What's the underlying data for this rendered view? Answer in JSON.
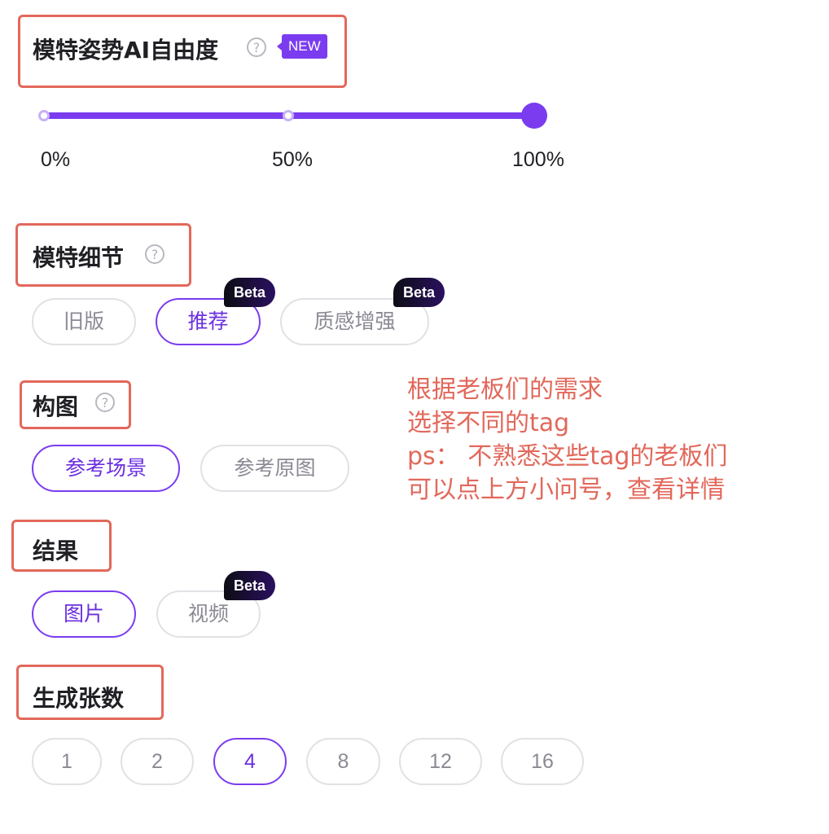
{
  "pose_freedom": {
    "title": "模特姿势AI自由度",
    "new_label": "NEW",
    "value_percent": 100,
    "ticks": [
      "0%",
      "50%",
      "100%"
    ]
  },
  "model_detail": {
    "title": "模特细节",
    "options": [
      "旧版",
      "推荐",
      "质感增强"
    ],
    "selected": "推荐",
    "beta_label": "Beta"
  },
  "composition": {
    "title": "构图",
    "options": [
      "参考场景",
      "参考原图"
    ],
    "selected": "参考场景"
  },
  "result": {
    "title": "结果",
    "options": [
      "图片",
      "视频"
    ],
    "selected": "图片",
    "beta_label": "Beta"
  },
  "count": {
    "title": "生成张数",
    "options": [
      "1",
      "2",
      "4",
      "8",
      "12",
      "16"
    ],
    "selected": "4"
  },
  "annotation": {
    "lines": [
      "根据老板们的需求",
      "选择不同的tag",
      "ps： 不熟悉这些tag的老板们",
      "可以点上方小问号，查看详情"
    ]
  },
  "colors": {
    "accent": "#7b3cf0",
    "highlight": "#e2685b"
  },
  "icons": {
    "help": "question-circle-icon"
  }
}
